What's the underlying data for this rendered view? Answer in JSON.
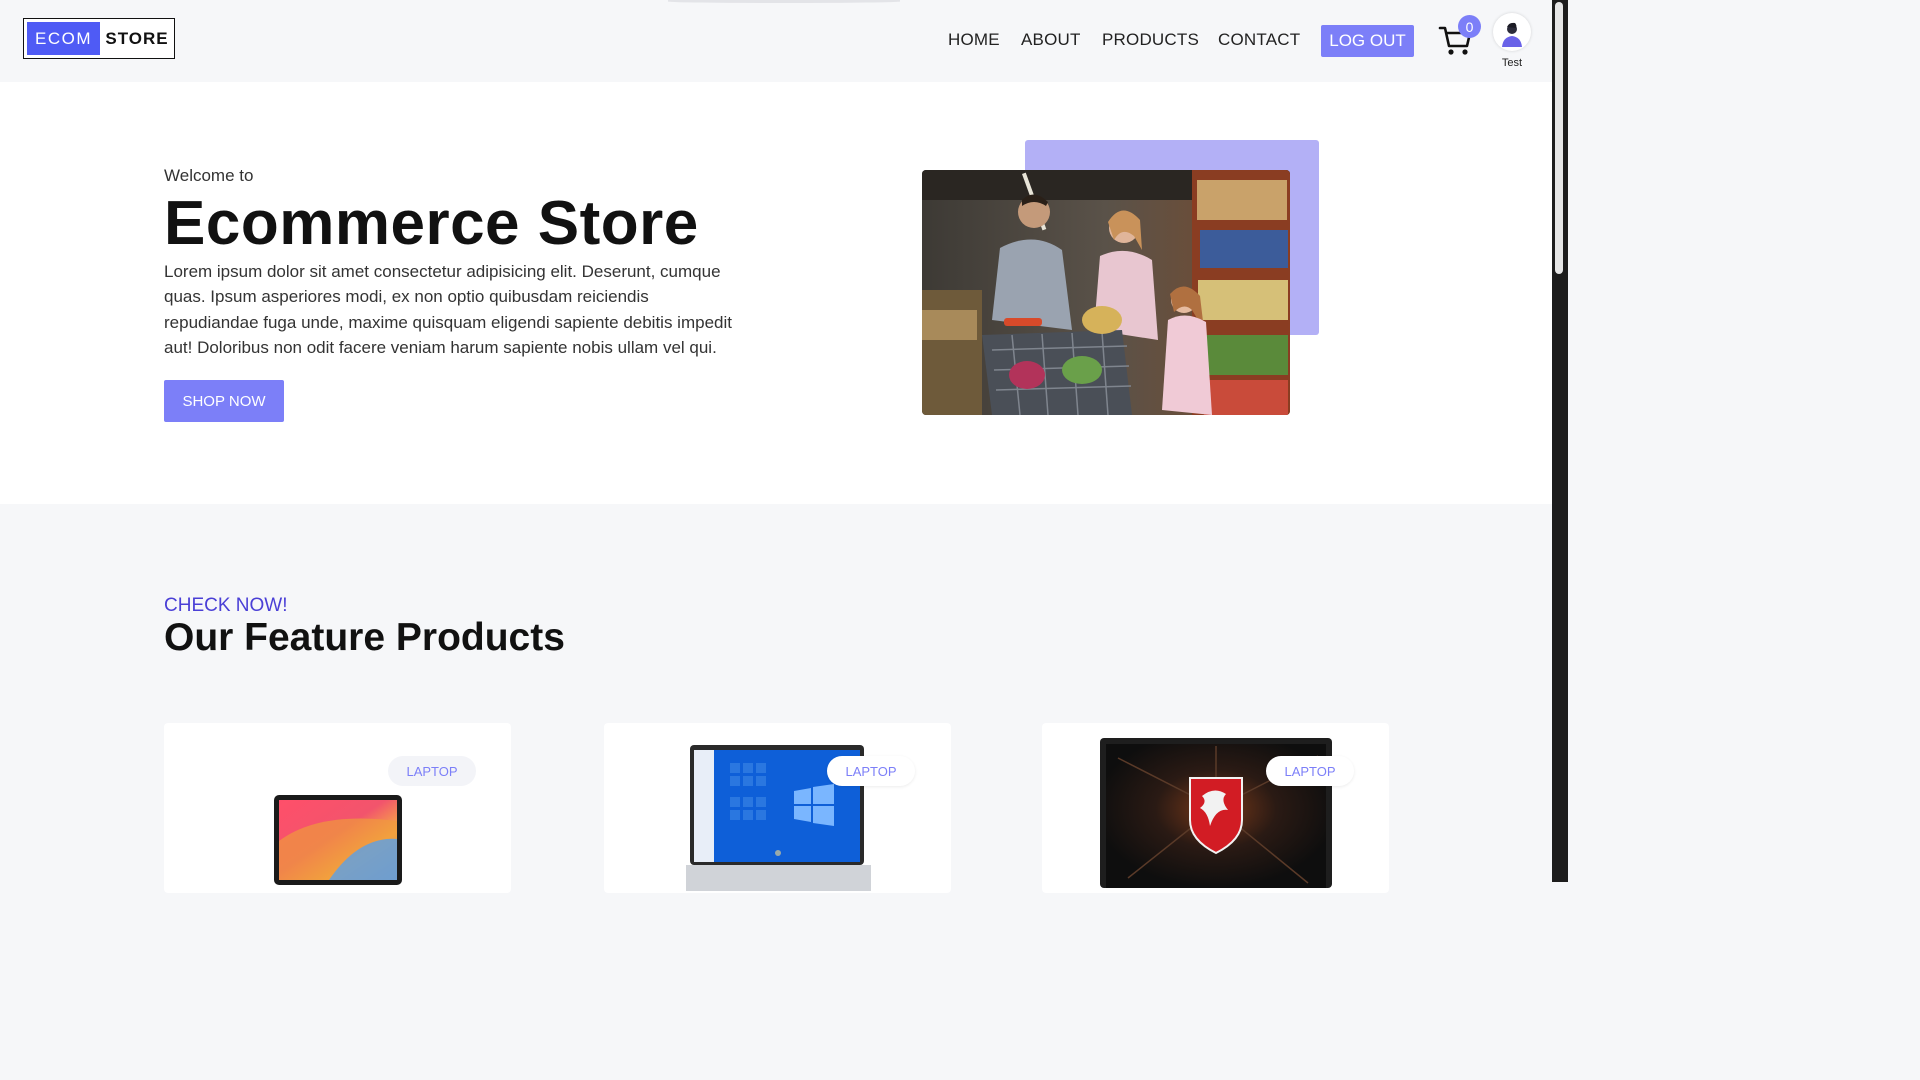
{
  "brand": {
    "part1": "ECOM",
    "part2": "STORE",
    "accent": "#4f5bf5"
  },
  "nav": {
    "home": "HOME",
    "about": "ABOUT",
    "products": "PRODUCTS",
    "contact": "CONTACT",
    "logout": "LOG OUT"
  },
  "cart": {
    "count": "0",
    "icon": "cart-icon"
  },
  "user": {
    "name": "Test",
    "icon": "avatar-icon"
  },
  "hero": {
    "welcome": "Welcome to",
    "title": "Ecommerce Store",
    "description": "Lorem ipsum dolor sit amet consectetur adipisicing elit. Deserunt, cumque quas. Ipsum asperiores modi, ex non optio quibusdam reiciendis repudiandae fuga unde, maxime quisquam eligendi sapiente debitis impedit aut! Doloribus non odit facere veniam harum sapiente nobis ullam vel qui.",
    "button": "SHOP NOW"
  },
  "features": {
    "eyebrow": "CHECK NOW!",
    "title": "Our Feature Products",
    "products": [
      {
        "tag": "LAPTOP"
      },
      {
        "tag": "LAPTOP"
      },
      {
        "tag": "LAPTOP"
      }
    ]
  },
  "colors": {
    "primary": "#7c7ff8",
    "eyebrow": "#4a3fd6",
    "heroAccent": "#b3b0f6"
  }
}
